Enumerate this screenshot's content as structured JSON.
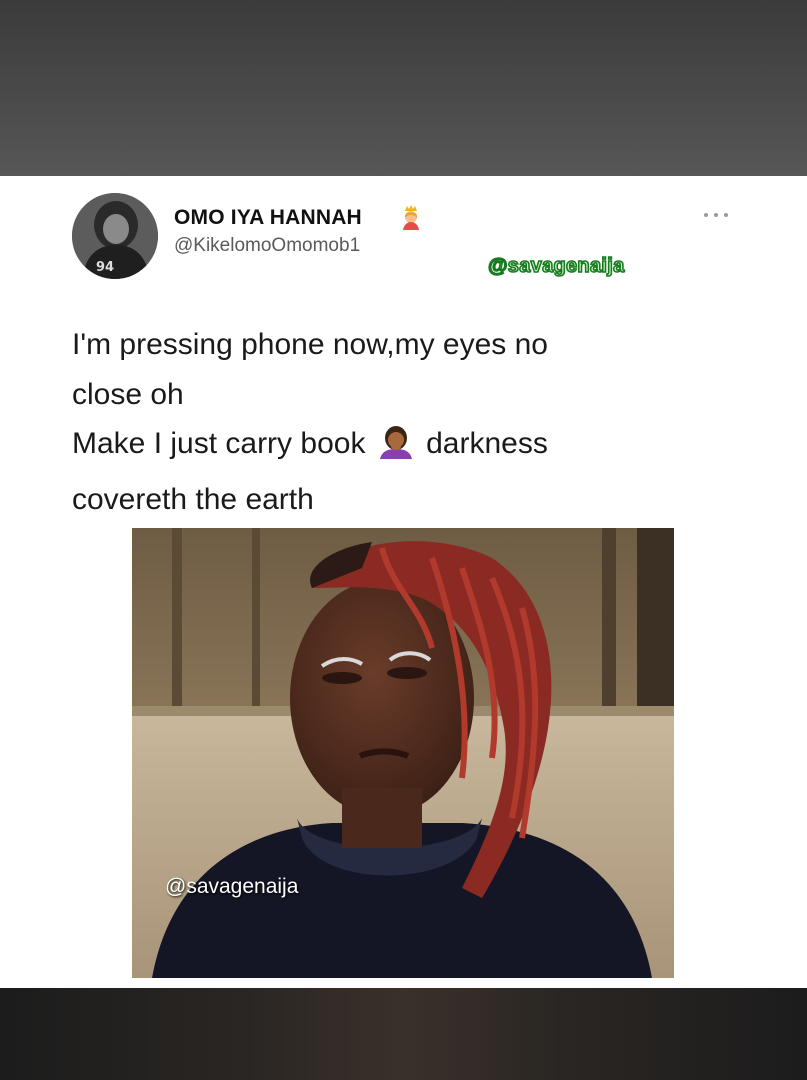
{
  "tweet": {
    "display_name": "OMO IYA HANNAH",
    "name_emoji": "princess-emoji",
    "handle": "@KikelomoOmomob1",
    "avatar_icon": "profile-photo",
    "more_icon": "more-options-icon",
    "text_lines": [
      "I'm pressing phone now,my eyes no",
      "close oh",
      "Make I just carry book",
      "darkness",
      "covereth the earth"
    ],
    "inline_emoji": "woman-facepalming-emoji"
  },
  "watermarks": {
    "top": "@savagenaija",
    "image": "@savagenaija"
  },
  "colors": {
    "card_bg": "#ffffff",
    "text": "#1a1a1a",
    "handle": "#5a5a5a",
    "watermark_green": "#167a1f"
  }
}
